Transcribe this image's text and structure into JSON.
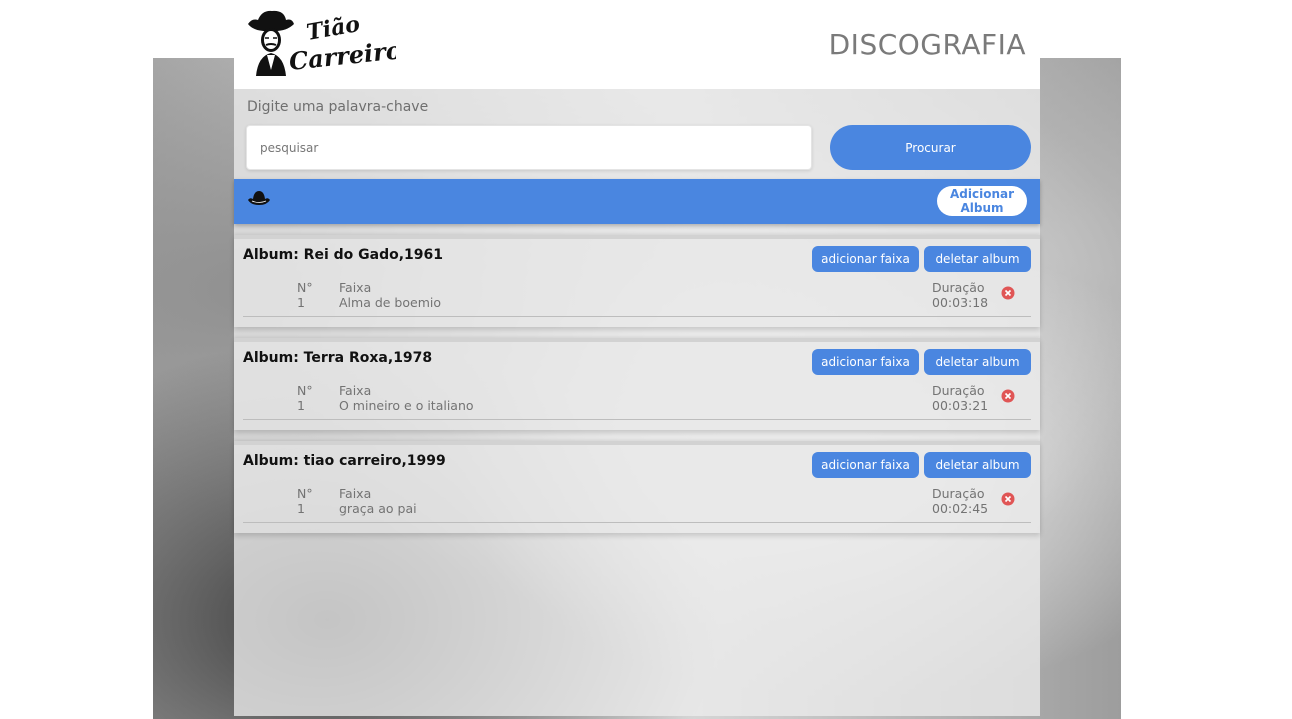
{
  "header": {
    "logo_text": "Tião Carreiro",
    "title": "DISCOGRAFIA"
  },
  "search": {
    "label": "Digite uma palavra-chave",
    "placeholder": "pesquisar",
    "value": "",
    "button_label": "Procurar"
  },
  "toolbar": {
    "icon": "cowboy-hat-icon",
    "add_album_label": "Adicionar\nAlbum"
  },
  "table_headers": {
    "number": "N°",
    "track": "Faixa",
    "duration": "Duração"
  },
  "albums": [
    {
      "title": "Album: Rei do Gado,1961",
      "add_track_label": "adicionar faixa",
      "delete_album_label": "deletar album",
      "tracks": [
        {
          "number": "1",
          "name": "Alma de boemio",
          "duration": "00:03:18"
        }
      ]
    },
    {
      "title": "Album: Terra Roxa,1978",
      "add_track_label": "adicionar faixa",
      "delete_album_label": "deletar album",
      "tracks": [
        {
          "number": "1",
          "name": "O mineiro e o italiano",
          "duration": "00:03:21"
        }
      ]
    },
    {
      "title": "Album: tiao carreiro,1999",
      "add_track_label": "adicionar faixa",
      "delete_album_label": "deletar album",
      "tracks": [
        {
          "number": "1",
          "name": "graça ao pai",
          "duration": "00:02:45"
        }
      ]
    }
  ],
  "colors": {
    "accent": "#4a86e0",
    "delete_icon": "#e05555",
    "title_gray": "#7a7a7a"
  }
}
